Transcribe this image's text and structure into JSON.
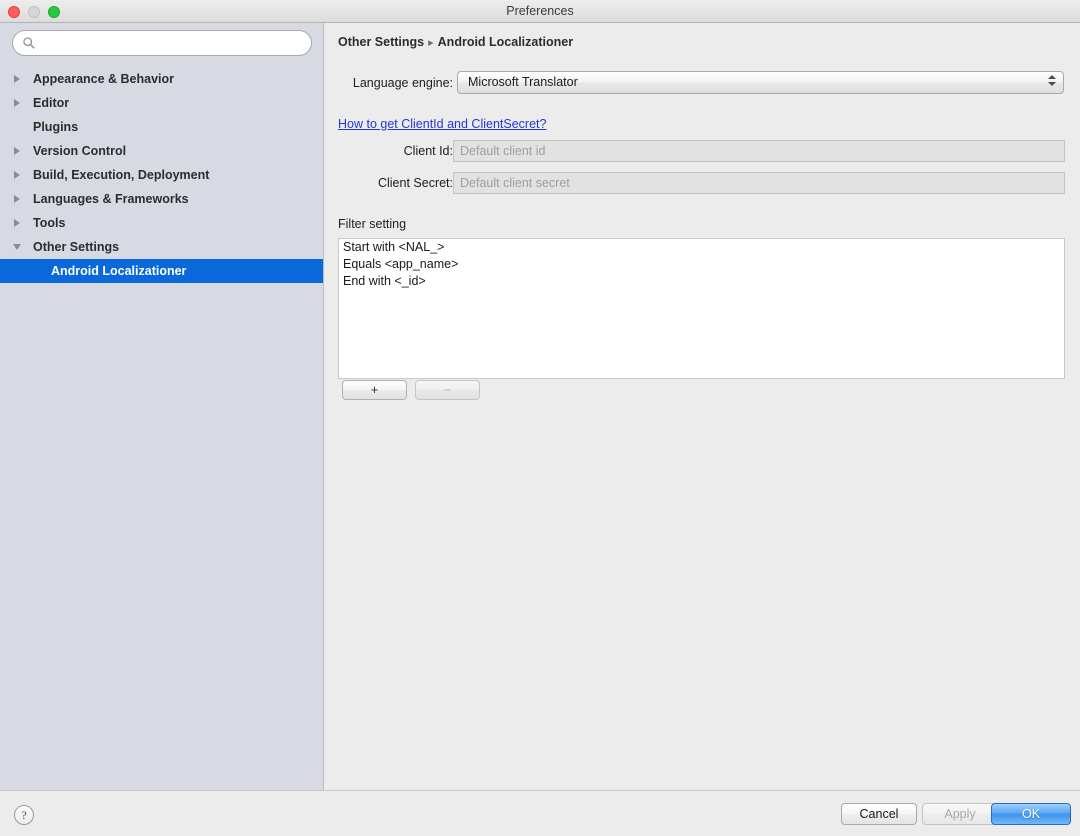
{
  "window": {
    "title": "Preferences",
    "traffic_lights": [
      "close",
      "minimize",
      "zoom"
    ]
  },
  "sidebar": {
    "search": {
      "value": "",
      "placeholder": ""
    },
    "items": [
      {
        "label": "Appearance & Behavior",
        "level": 0,
        "twisty": "collapsed",
        "selected": false
      },
      {
        "label": "Editor",
        "level": 0,
        "twisty": "collapsed",
        "selected": false
      },
      {
        "label": "Plugins",
        "level": 0,
        "twisty": "none",
        "selected": false
      },
      {
        "label": "Version Control",
        "level": 0,
        "twisty": "collapsed",
        "selected": false
      },
      {
        "label": "Build, Execution, Deployment",
        "level": 0,
        "twisty": "collapsed",
        "selected": false
      },
      {
        "label": "Languages & Frameworks",
        "level": 0,
        "twisty": "collapsed",
        "selected": false
      },
      {
        "label": "Tools",
        "level": 0,
        "twisty": "collapsed",
        "selected": false
      },
      {
        "label": "Other Settings",
        "level": 0,
        "twisty": "expanded",
        "selected": false
      },
      {
        "label": "Android Localizationer",
        "level": 1,
        "twisty": "none",
        "selected": true
      }
    ]
  },
  "main": {
    "breadcrumb": {
      "parent": "Other Settings",
      "separator": "▸",
      "current": "Android Localizationer"
    },
    "engine": {
      "label": "Language engine:",
      "selected": "Microsoft Translator"
    },
    "howto_link": "How to get ClientId and ClientSecret?",
    "client_id": {
      "label": "Client Id:",
      "value": "",
      "placeholder": "Default client id"
    },
    "client_secret": {
      "label": "Client Secret:",
      "value": "",
      "placeholder": "Default client secret"
    },
    "filter": {
      "caption": "Filter setting",
      "items": [
        "Start with <NAL_>",
        "Equals <app_name>",
        "End with <_id>"
      ],
      "add_label": "+",
      "remove_label": "−"
    }
  },
  "footer": {
    "help_label": "?",
    "cancel_label": "Cancel",
    "apply_label": "Apply",
    "ok_label": "OK"
  },
  "colors": {
    "selection_blue": "#0a69da",
    "link_blue": "#2137d8",
    "sidebar_bg": "#d8dae3",
    "panel_bg": "#ececec",
    "default_button_blue": "#3f93ee"
  }
}
